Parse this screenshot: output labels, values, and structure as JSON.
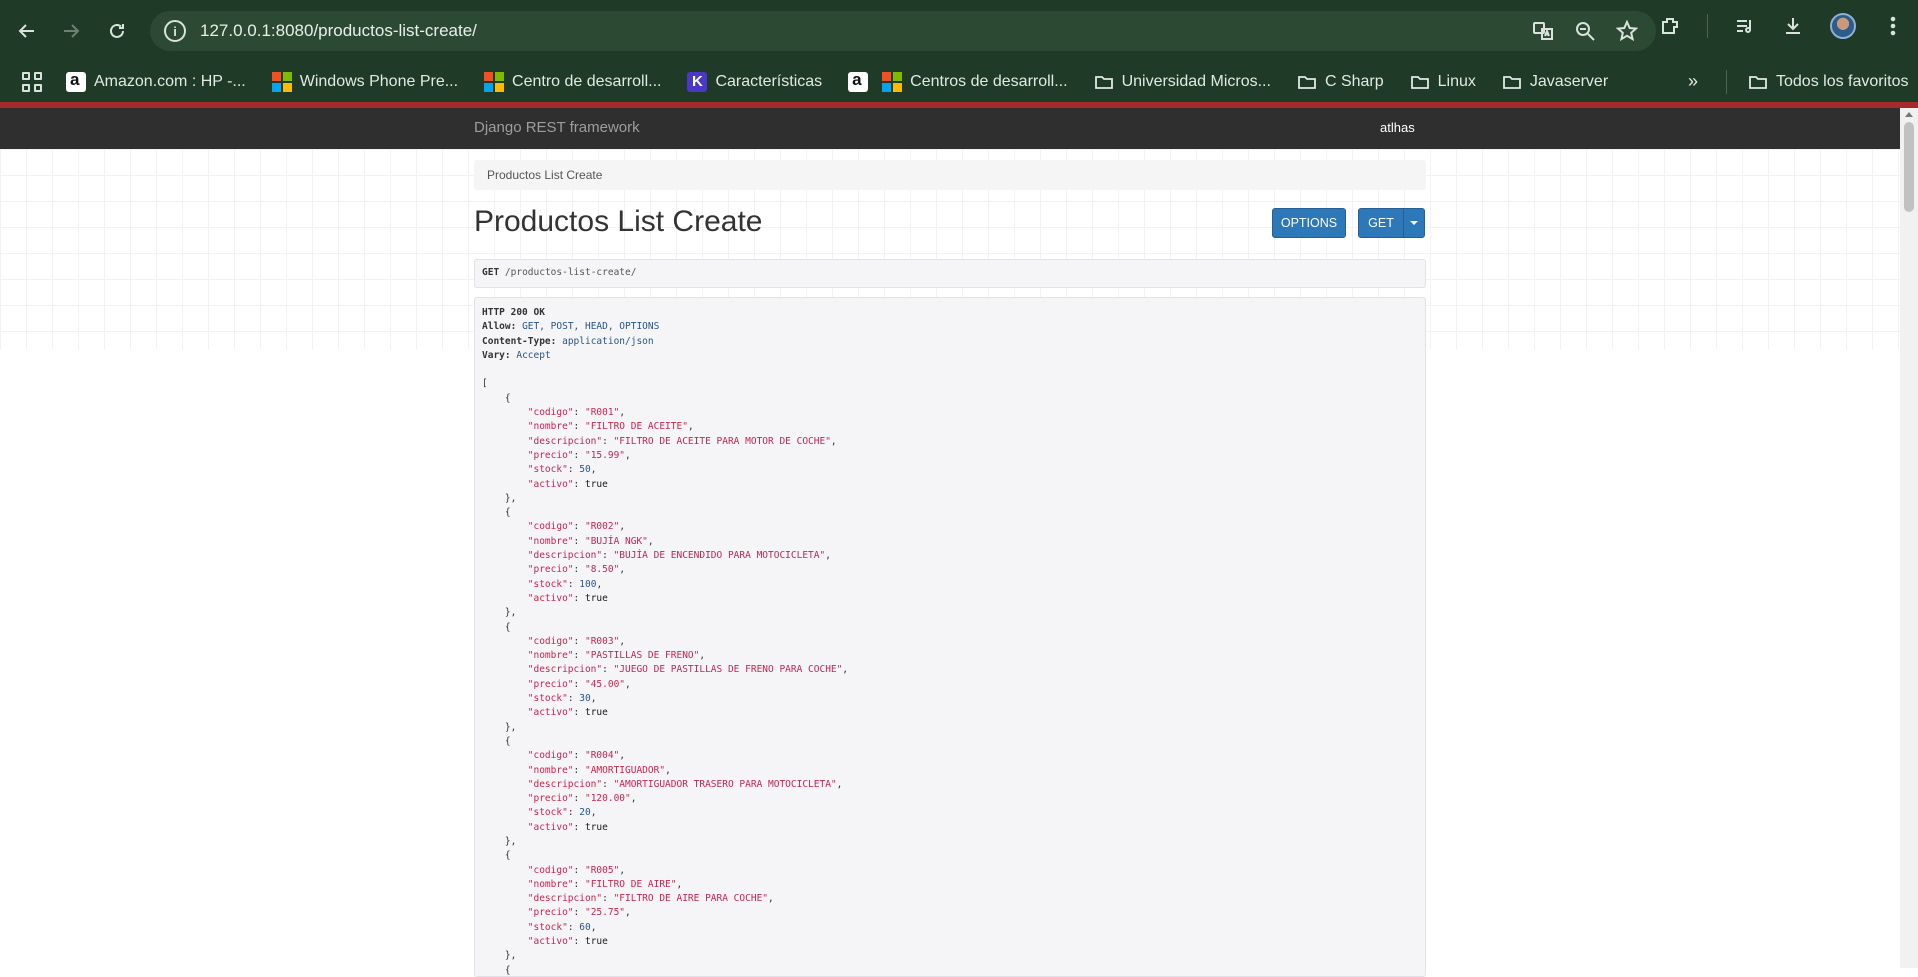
{
  "browser": {
    "url": "127.0.0.1:8080/productos-list-create/",
    "bookmarks": [
      {
        "label": "Amazon.com : HP -...",
        "icon": "amazon-icon"
      },
      {
        "label": "Windows Phone Pre...",
        "icon": "microsoft-icon"
      },
      {
        "label": "Centro de desarroll...",
        "icon": "microsoft-icon"
      },
      {
        "label": "Características",
        "icon": "k-icon"
      },
      {
        "label": "",
        "icon": "amazon-icon"
      },
      {
        "label": "Centros de desarroll...",
        "icon": "microsoft-icon"
      },
      {
        "label": "Universidad Micros...",
        "icon": "folder-icon"
      },
      {
        "label": "C Sharp",
        "icon": "folder-icon"
      },
      {
        "label": "Linux",
        "icon": "folder-icon"
      },
      {
        "label": "Javaserver",
        "icon": "folder-icon"
      }
    ],
    "all_bookmarks": "Todos los favoritos"
  },
  "drf": {
    "brand": "Django REST framework",
    "user": "atlhas",
    "breadcrumb": "Productos List Create",
    "title": "Productos List Create",
    "options_label": "OPTIONS",
    "get_label": "GET",
    "request_method": "GET",
    "request_path": "/productos-list-create/"
  },
  "response": {
    "status": "HTTP 200 OK",
    "headers": [
      {
        "name": "Allow:",
        "value": "GET, POST, HEAD, OPTIONS"
      },
      {
        "name": "Content-Type:",
        "value": "application/json"
      },
      {
        "name": "Vary:",
        "value": "Accept"
      }
    ],
    "items": [
      {
        "codigo": "R001",
        "nombre": "FILTRO DE ACEITE",
        "descripcion": "FILTRO DE ACEITE PARA MOTOR DE COCHE",
        "precio": "15.99",
        "stock": "50",
        "activo": "true"
      },
      {
        "codigo": "R002",
        "nombre": "BUJÍA NGK",
        "descripcion": "BUJÍA DE ENCENDIDO PARA MOTOCICLETA",
        "precio": "8.50",
        "stock": "100",
        "activo": "true"
      },
      {
        "codigo": "R003",
        "nombre": "PASTILLAS DE FRENO",
        "descripcion": "JUEGO DE PASTILLAS DE FRENO PARA COCHE",
        "precio": "45.00",
        "stock": "30",
        "activo": "true"
      },
      {
        "codigo": "R004",
        "nombre": "AMORTIGUADOR",
        "descripcion": "AMORTIGUADOR TRASERO PARA MOTOCICLETA",
        "precio": "120.00",
        "stock": "20",
        "activo": "true"
      },
      {
        "codigo": "R005",
        "nombre": "FILTRO DE AIRE",
        "descripcion": "FILTRO DE AIRE PARA COCHE",
        "precio": "25.75",
        "stock": "60",
        "activo": "true"
      }
    ]
  }
}
